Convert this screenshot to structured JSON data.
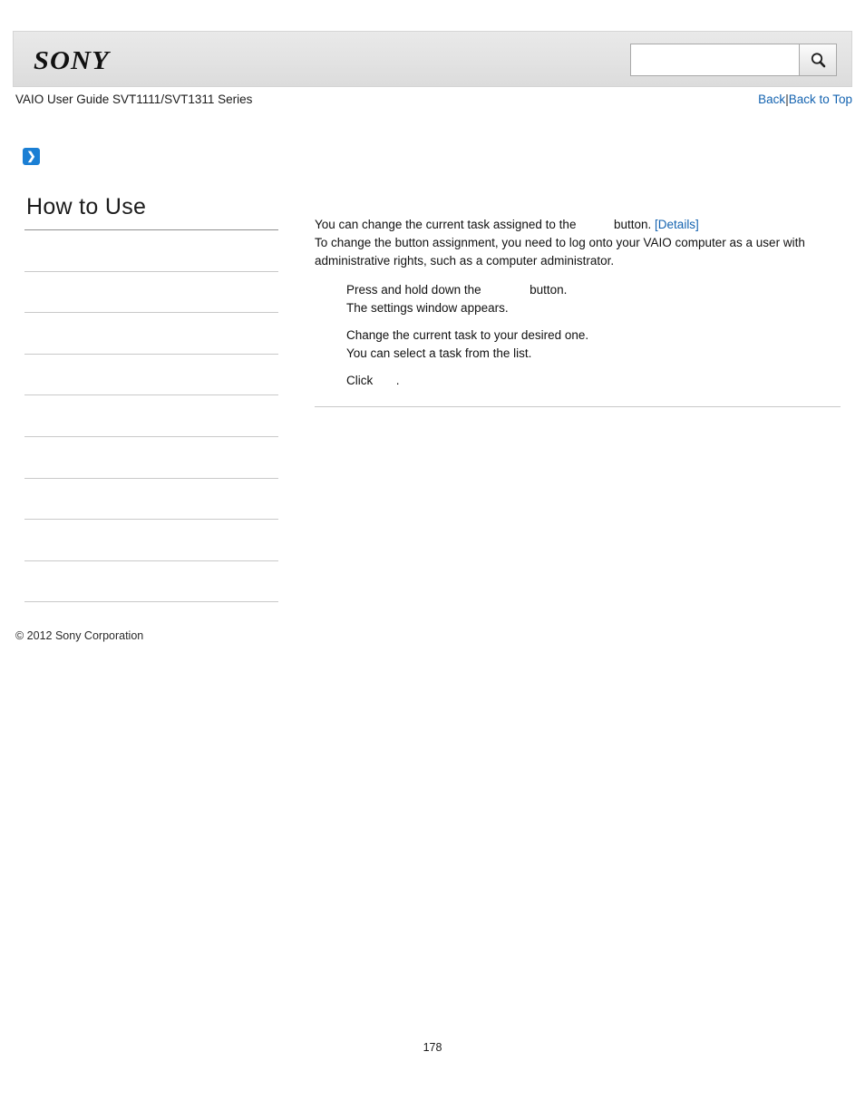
{
  "header": {
    "logo_text": "SONY",
    "search": {
      "value": "",
      "placeholder": "",
      "icon": "search-icon"
    }
  },
  "title_row": {
    "guide_title": "VAIO User Guide SVT1111/SVT1311 Series",
    "back_label": "Back",
    "separator": "|",
    "back_to_top_label": "Back to Top"
  },
  "marker": {
    "glyph": "❯"
  },
  "sidebar": {
    "heading": "How to Use",
    "items": [
      {
        "label": ""
      },
      {
        "label": ""
      },
      {
        "label": ""
      },
      {
        "label": ""
      },
      {
        "label": ""
      },
      {
        "label": ""
      },
      {
        "label": ""
      },
      {
        "label": ""
      },
      {
        "label": ""
      },
      {
        "label": ""
      }
    ],
    "copyright": "© 2012 Sony Corporation"
  },
  "main": {
    "intro_line1_before": "You can change the current task assigned to the",
    "intro_line1_after": "button.",
    "details_label": "[Details]",
    "intro_line2": "To change the button assignment, you need to log onto your VAIO computer as a user with",
    "intro_line3": "administrative rights, such as a computer administrator.",
    "steps": [
      {
        "line1_before": "Press and hold down the",
        "line1_after": "button.",
        "line2": "The settings window appears."
      },
      {
        "line1_before": "Change the current task to your desired one.",
        "line1_after": "",
        "line2": "You can select a task from the list."
      },
      {
        "line1_before": "Click",
        "line1_after": ".",
        "line2": ""
      }
    ]
  },
  "footer": {
    "page_number": "178"
  },
  "colors": {
    "link": "#1463b0",
    "accent": "#1b7fd4",
    "header_bg": "#e4e4e4"
  }
}
